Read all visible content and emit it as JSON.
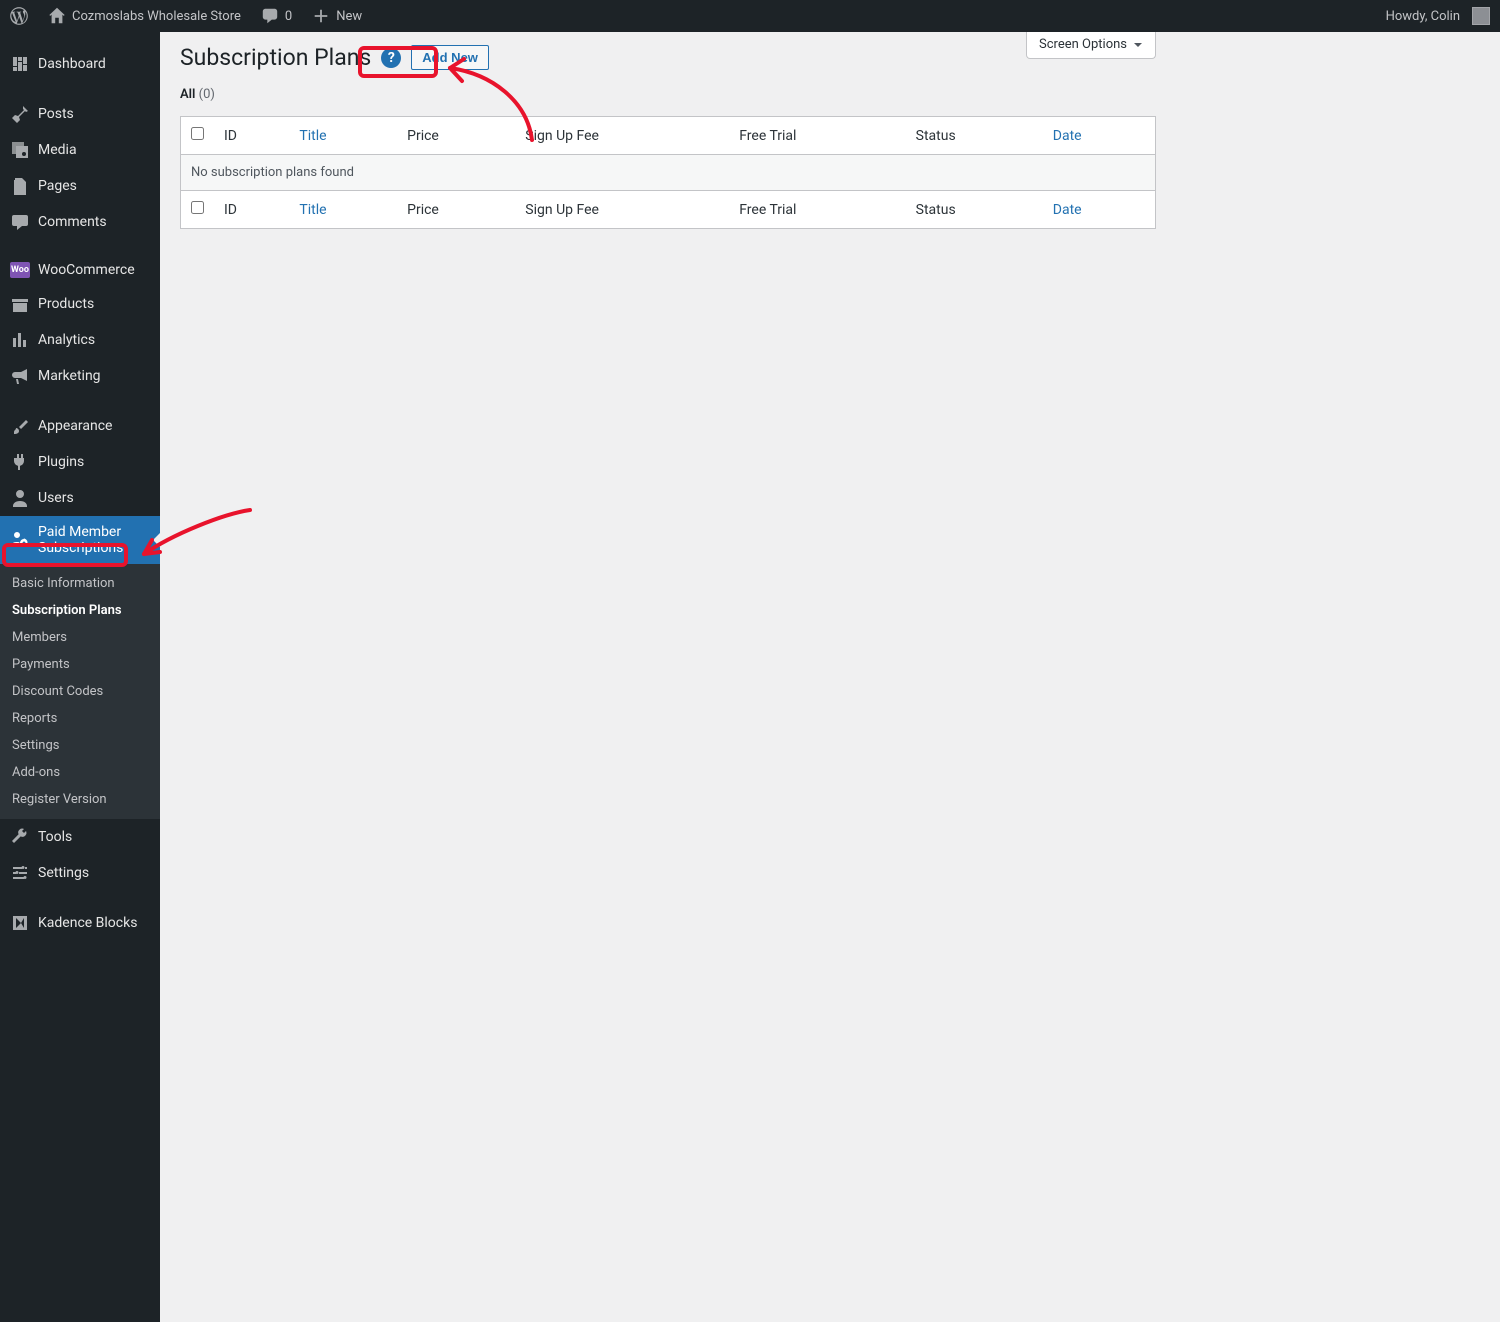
{
  "adminbar": {
    "site_name": "Cozmoslabs Wholesale Store",
    "comments_count": "0",
    "new_label": "New",
    "howdy": "Howdy, Colin"
  },
  "sidebar": {
    "items": [
      {
        "label": "Dashboard"
      },
      {
        "label": "Posts"
      },
      {
        "label": "Media"
      },
      {
        "label": "Pages"
      },
      {
        "label": "Comments"
      },
      {
        "label": "WooCommerce"
      },
      {
        "label": "Products"
      },
      {
        "label": "Analytics"
      },
      {
        "label": "Marketing"
      },
      {
        "label": "Appearance"
      },
      {
        "label": "Plugins"
      },
      {
        "label": "Users"
      },
      {
        "label": "Paid Member Subscriptions"
      },
      {
        "label": "Tools"
      },
      {
        "label": "Settings"
      },
      {
        "label": "Kadence Blocks"
      }
    ],
    "submenu": [
      "Basic Information",
      "Subscription Plans",
      "Members",
      "Payments",
      "Discount Codes",
      "Reports",
      "Settings",
      "Add-ons",
      "Register Version"
    ]
  },
  "page": {
    "title": "Subscription Plans",
    "add_new": "Add New",
    "screen_options": "Screen Options",
    "filter_all": "All",
    "filter_count": "(0)",
    "empty_message": "No subscription plans found",
    "columns": {
      "id": "ID",
      "title": "Title",
      "price": "Price",
      "signup_fee": "Sign Up Fee",
      "free_trial": "Free Trial",
      "status": "Status",
      "date": "Date"
    }
  }
}
